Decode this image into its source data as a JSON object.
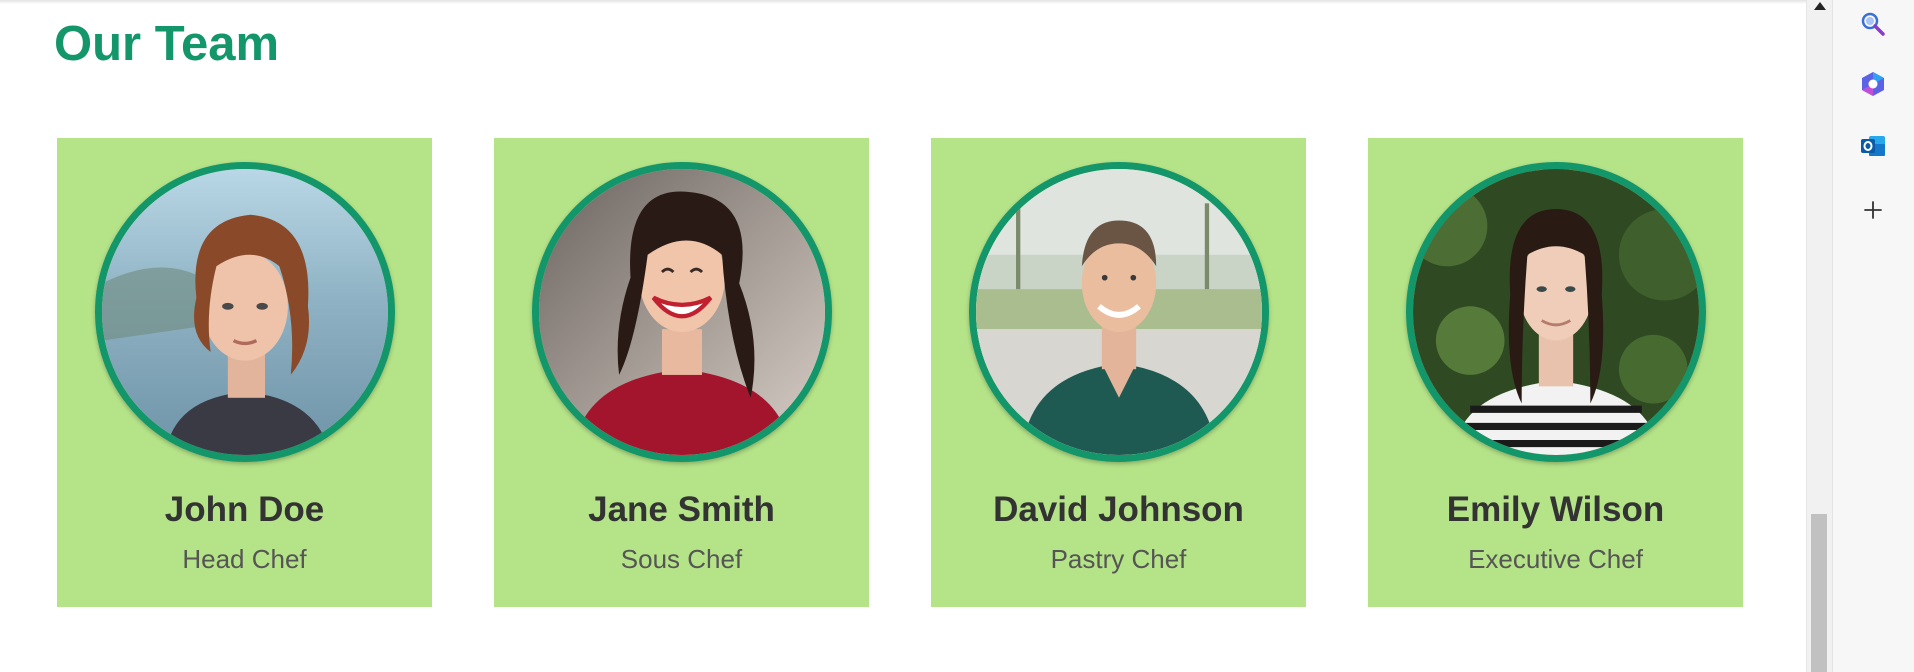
{
  "section": {
    "title": "Our Team"
  },
  "team": [
    {
      "name": "John Doe",
      "role": "Head Chef"
    },
    {
      "name": "Jane Smith",
      "role": "Sous Chef"
    },
    {
      "name": "David Johnson",
      "role": "Pastry Chef"
    },
    {
      "name": "Emily Wilson",
      "role": "Executive Chef"
    }
  ],
  "sidebar": {
    "icons": [
      "search-icon",
      "copilot-icon",
      "outlook-icon",
      "add-icon"
    ]
  },
  "colors": {
    "accent": "#12966a",
    "card_background": "#b5e388",
    "name_text": "#333333",
    "role_text": "#555555"
  }
}
